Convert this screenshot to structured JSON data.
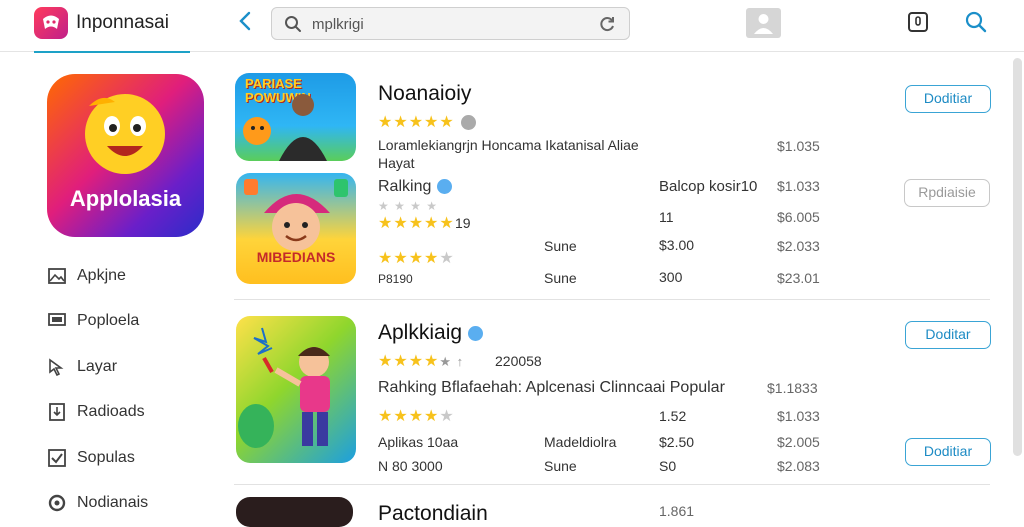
{
  "app": {
    "name": "Inponnasai"
  },
  "search": {
    "query": "mplkrigi"
  },
  "sidebar": {
    "tile_name": "Applolasia",
    "items": [
      {
        "label": "Apkjne",
        "icon": "image-icon"
      },
      {
        "label": "Poploela",
        "icon": "monitor-icon"
      },
      {
        "label": "Layar",
        "icon": "cursor-icon"
      },
      {
        "label": "Radioads",
        "icon": "download-icon"
      },
      {
        "label": "Sopulas",
        "icon": "checkbox-icon"
      },
      {
        "label": "Nodianais",
        "icon": "circle-icon"
      }
    ]
  },
  "listing": {
    "item1": {
      "thumb_text": "PARIASE POWUWIN",
      "title": "Noanaioiy",
      "desc": "Loramlekiangrjn Honcama Ikatanisal Aliae",
      "desc2": "Hayat",
      "price": "$1.035",
      "button": "Doditiar"
    },
    "item2": {
      "thumb_text": "MIBEDIANS",
      "title": "Ralking",
      "note": "Balcop kosir10",
      "price1": "$1.033",
      "button": "Rpdiaisie",
      "rating_label": "19",
      "col_a": "11",
      "price2": "$6.005",
      "row3_label": "Sune",
      "row3_value": "$3.00",
      "price3": "$2.033",
      "sub_label": "P8190",
      "row4_label": "Sune",
      "row4_value": "300",
      "price4": "$23.01"
    },
    "item3": {
      "title": "Aplkkiaig",
      "rating_label": "220058",
      "line": "Rahking Bflafaehah: Aplcenasi Clinncaai Popular",
      "line_price": "$1.1833",
      "col_a": "1.52",
      "price2": "$1.033",
      "detail_label": "Aplikas 10aa",
      "detail_mid": "Madeldiolra",
      "detail_value": "$2.50",
      "price3": "$2.005",
      "footer_label": "N 80 3000",
      "footer_mid": "Sune",
      "footer_value": "S0",
      "price4": "$2.083",
      "button_top": "Doditar",
      "button_bottom": "Doditiar"
    },
    "item4": {
      "title": "Pactondiain",
      "price": "1.861"
    }
  },
  "colors": {
    "accent": "#1da1c7",
    "star": "#f7c21c",
    "button_border": "#3aa4d5"
  }
}
